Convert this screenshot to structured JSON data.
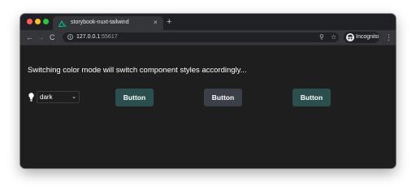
{
  "browser": {
    "tab": {
      "title": "storybook-nuxt-tailwind",
      "close_glyph": "×",
      "favicon": "nuxt-logo-icon"
    },
    "new_tab_glyph": "+",
    "nav": {
      "back_glyph": "←",
      "forward_glyph": "→",
      "reload_glyph": "C"
    },
    "address": {
      "host": "127.0.0.1",
      "port": ":55617"
    },
    "zoom_glyph": "⚲",
    "bookmark_glyph": "☆",
    "profile_label": "Incognito",
    "menu_glyph": "⋮",
    "traffic_colors": {
      "close": "#ff5f57",
      "minimize": "#febc2e",
      "maximize": "#28c840"
    }
  },
  "page": {
    "heading": "Switching color mode will switch component styles accordingly...",
    "theme_select": {
      "selected": "dark",
      "arrow_glyph": "⌄"
    },
    "buttons": [
      {
        "label": "Button",
        "color": "#2a4f4e"
      },
      {
        "label": "Button",
        "color": "#3b3f47"
      },
      {
        "label": "Button",
        "color": "#2a4f4e"
      }
    ]
  }
}
